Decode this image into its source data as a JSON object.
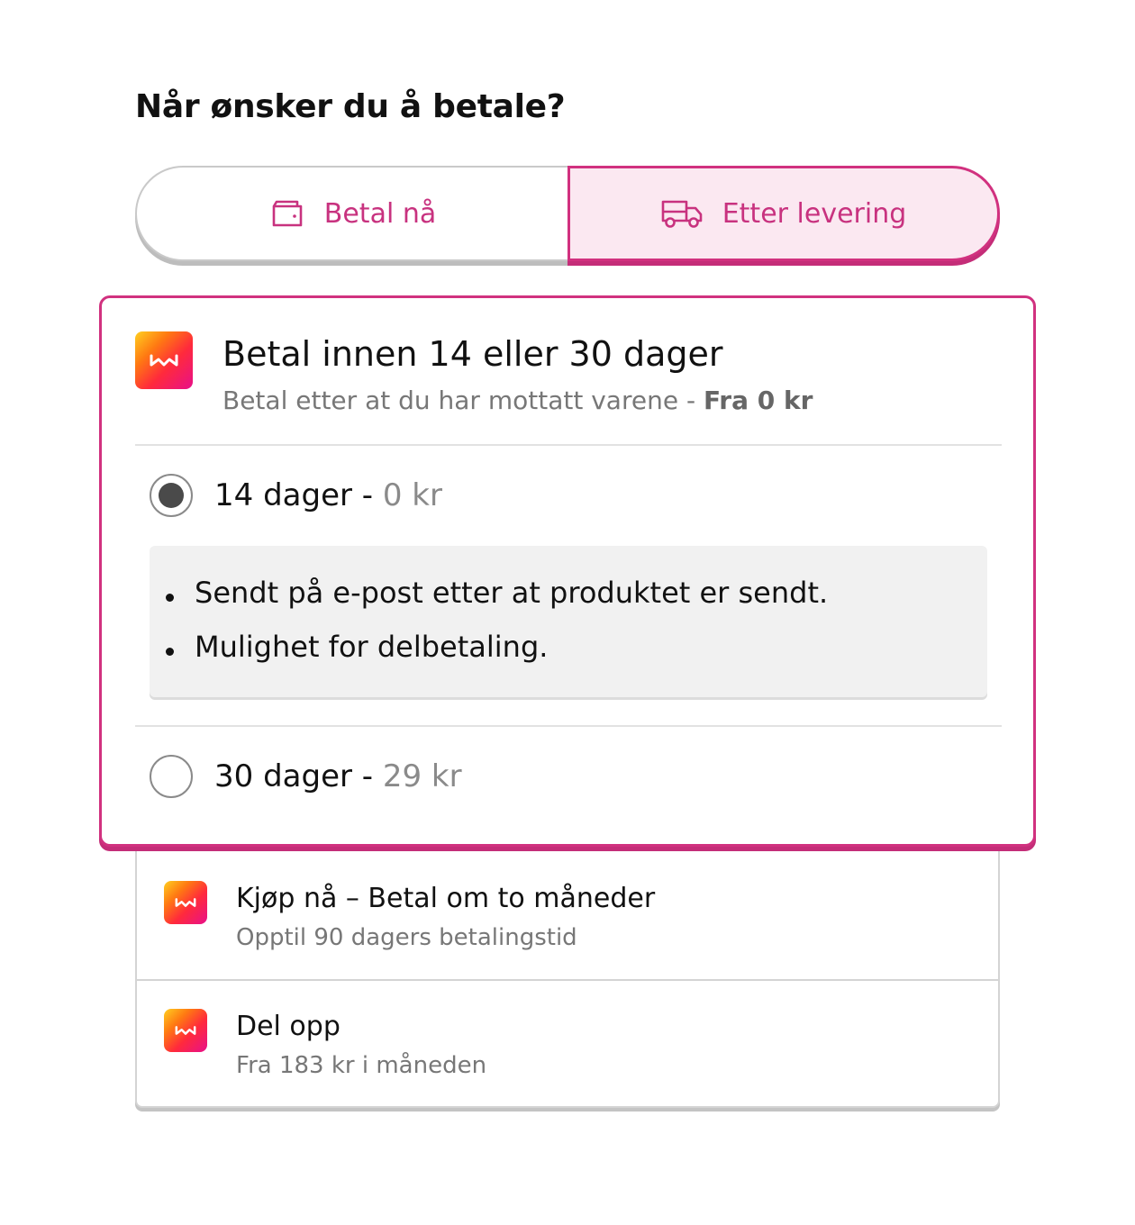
{
  "heading": "Når ønsker du å betale?",
  "toggle": {
    "left": {
      "label": "Betal nå",
      "icon": "wallet-icon"
    },
    "right": {
      "label": "Etter levering",
      "icon": "truck-icon",
      "selected": true
    }
  },
  "selected_card": {
    "title": "Betal innen 14 eller 30 dager",
    "subtitle": "Betal etter at du har mottatt varene - ",
    "subtitle_bold": "Fra 0 kr",
    "options": [
      {
        "label": "14 dager - ",
        "price": "0 kr",
        "checked": true
      },
      {
        "label": "30 dager - ",
        "price": "29 kr",
        "checked": false
      }
    ],
    "info_bullets": [
      "Sendt på e-post etter at produktet er sendt.",
      "Mulighet for delbetaling."
    ]
  },
  "other_options": [
    {
      "title": "Kjøp nå – Betal om to måneder",
      "subtitle": "Opptil 90 dagers betalingstid"
    },
    {
      "title": "Del opp",
      "subtitle": "Fra 183 kr i måneden"
    }
  ],
  "colors": {
    "accent": "#d1317f",
    "accent_bg": "#fbe8f1",
    "muted_text": "#777777"
  }
}
